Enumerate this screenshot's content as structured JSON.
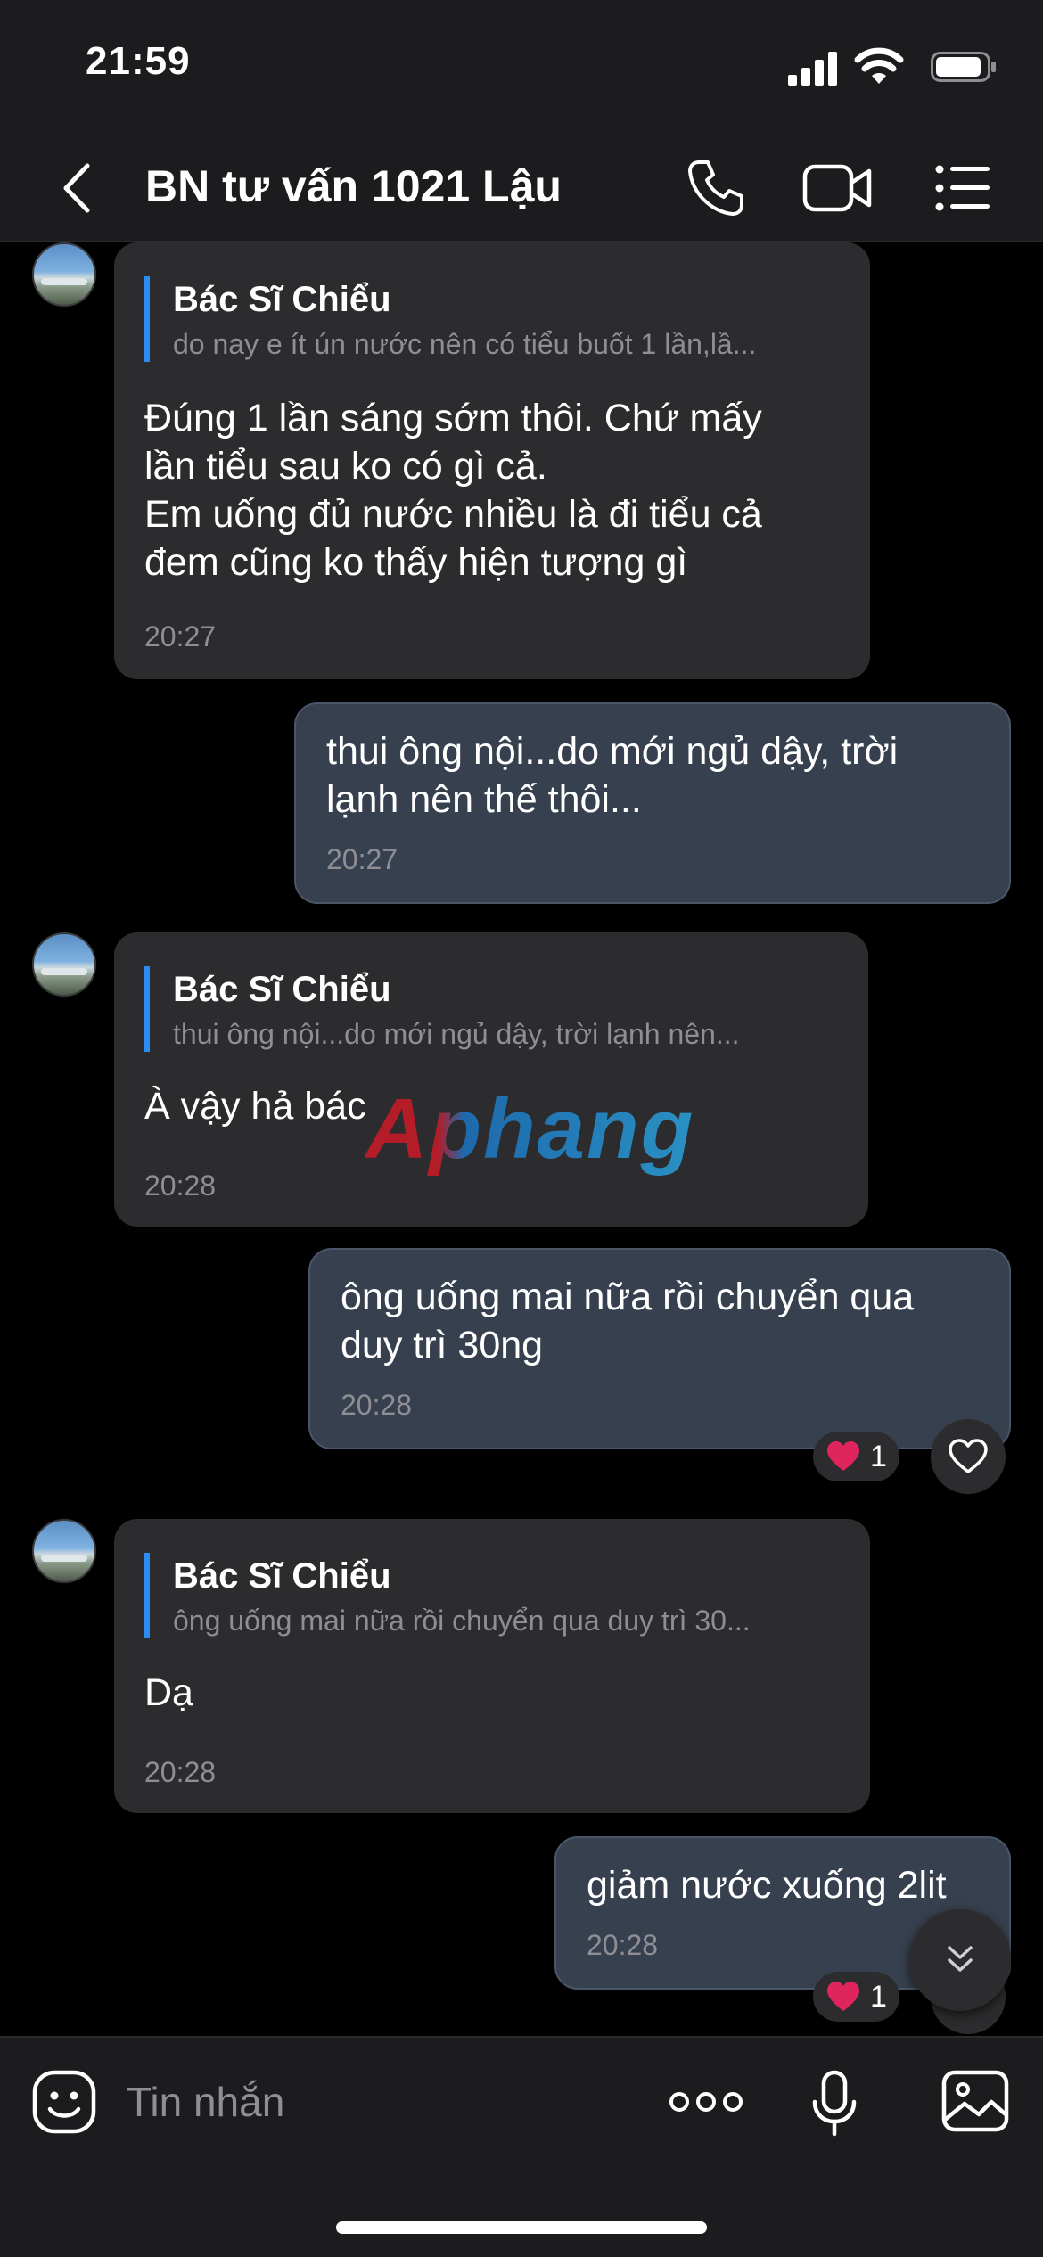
{
  "status": {
    "time": "21:59"
  },
  "header": {
    "title": "BN tư vấn 1021 Lậu"
  },
  "messages": [
    {
      "direction": "in",
      "quote_name": "Bác Sĩ Chiểu",
      "quote_text": "do nay e ít  ún nước  nên có tiểu buốt 1 lần,lầ...",
      "text": "Đúng 1 lần sáng sớm thôi. Chứ mấy\nlần tiểu sau ko có gì cả.\nEm uống đủ nước nhiều là đi tiểu cả\nđem cũng ko thấy hiện tượng gì",
      "time": "20:27"
    },
    {
      "direction": "out",
      "text": "thui  ông  nội...do mới ngủ  dậy, trời\nlạnh nên thế thôi...",
      "time": "20:27"
    },
    {
      "direction": "in",
      "quote_name": "Bác Sĩ Chiểu",
      "quote_text": "thui  ông  nội...do mới ngủ  dậy, trời lạnh nên...",
      "text": "À vậy hả bác",
      "time": "20:28"
    },
    {
      "direction": "out",
      "text": "ông uống mai  nữa  rồi chuyển qua\nduy trì 30ng",
      "time": "20:28",
      "reaction_count": "1"
    },
    {
      "direction": "in",
      "quote_name": "Bác Sĩ Chiểu",
      "quote_text": "ông uống mai  nữa  rồi chuyển qua duy trì 30...",
      "text": "Dạ",
      "time": "20:28"
    },
    {
      "direction": "out",
      "text": "giảm nước xuống  2lit",
      "time": "20:28",
      "reaction_count": "1"
    }
  ],
  "watermark": "Aphang",
  "input": {
    "placeholder": "Tin nhắn"
  },
  "colors": {
    "accent": "#2d8cf0",
    "bubble_in": "#2c2c2e",
    "bubble_out": "#37404e",
    "heart": "#e0245e"
  }
}
